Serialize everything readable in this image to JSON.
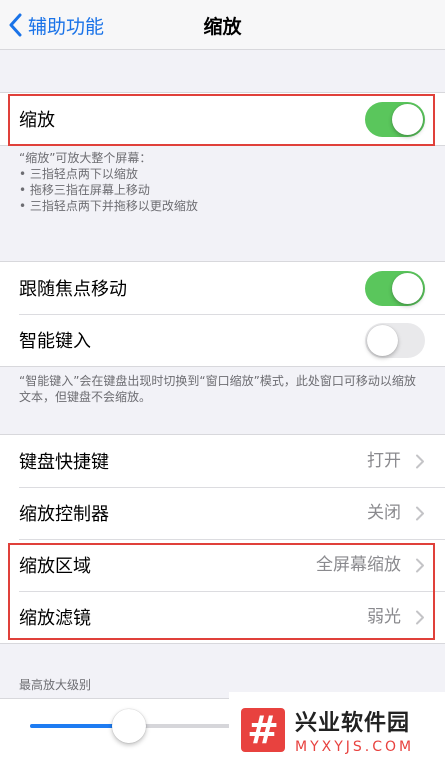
{
  "nav": {
    "back_label": "辅助功能",
    "title": "缩放"
  },
  "zoom_group": {
    "label": "缩放",
    "enabled": true
  },
  "zoom_note": {
    "intro": "“缩放”可放大整个屏幕：",
    "bullets": [
      "• 三指轻点两下以缩放",
      "• 拖移三指在屏幕上移动",
      "• 三指轻点两下并拖移以更改缩放"
    ]
  },
  "focus_group": {
    "follow_focus": {
      "label": "跟随焦点移动",
      "enabled": true
    },
    "smart_typing": {
      "label": "智能键入",
      "enabled": false
    }
  },
  "smart_typing_note": "“智能键入”会在键盘出现时切换到“窗口缩放”模式，此处窗口可移动以缩放文本，但键盘不会缩放。",
  "settings_group": {
    "keyboard_shortcuts": {
      "label": "键盘快捷键",
      "value": "打开"
    },
    "zoom_controller": {
      "label": "缩放控制器",
      "value": "关闭"
    },
    "zoom_region": {
      "label": "缩放区域",
      "value": "全屏幕缩放"
    },
    "zoom_filter": {
      "label": "缩放滤镜",
      "value": "弱光"
    }
  },
  "max_zoom": {
    "label": "最高放大级别",
    "level_fraction": 0.38
  },
  "watermark": {
    "name": "兴业软件园",
    "url": "MYXYJS.COM"
  },
  "colors": {
    "accent": "#1a73e8",
    "toggle_on": "#5ac65c",
    "highlight": "#e0403a"
  }
}
